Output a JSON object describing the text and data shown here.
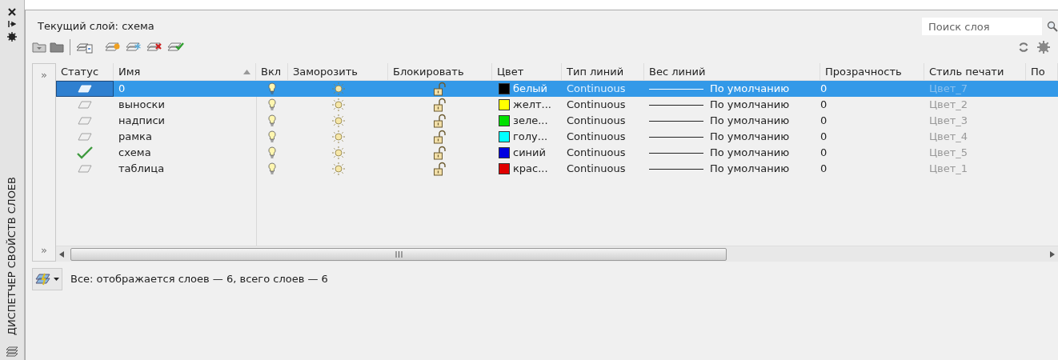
{
  "side_strip": {
    "title": "ДИСПЕТЧЕР СВОЙСТВ СЛОЕВ"
  },
  "current_layer": "Текущий слой: схема",
  "search": {
    "placeholder": "Поиск слоя"
  },
  "expand_marks": [
    "»",
    "»"
  ],
  "table": {
    "columns": [
      {
        "label": "Статус",
        "sorted": false
      },
      {
        "label": "Имя",
        "sorted": true
      },
      {
        "label": "Вкл",
        "sorted": false
      },
      {
        "label": "Заморозить",
        "sorted": false
      },
      {
        "label": "Блокировать",
        "sorted": false
      },
      {
        "label": "Цвет",
        "sorted": false
      },
      {
        "label": "Тип линий",
        "sorted": false
      },
      {
        "label": "Вес линий",
        "sorted": false
      },
      {
        "label": "Прозрачность",
        "sorted": false
      },
      {
        "label": "Стиль печати",
        "sorted": false
      },
      {
        "label": "По",
        "sorted": false
      }
    ],
    "rows": [
      {
        "current": false,
        "name": "0",
        "on": true,
        "frozen": false,
        "locked": false,
        "color": "#000000",
        "color_name": "белый",
        "linetype": "Continuous",
        "lineweight": "По умолчанию",
        "transparency": "0",
        "plot_style": "Цвет_7",
        "selected": true
      },
      {
        "current": false,
        "name": "выноски",
        "on": true,
        "frozen": false,
        "locked": false,
        "color": "#ffff00",
        "color_name": "желт...",
        "linetype": "Continuous",
        "lineweight": "По умолчанию",
        "transparency": "0",
        "plot_style": "Цвет_2",
        "selected": false
      },
      {
        "current": false,
        "name": "надписи",
        "on": true,
        "frozen": false,
        "locked": false,
        "color": "#00e000",
        "color_name": "зеле...",
        "linetype": "Continuous",
        "lineweight": "По умолчанию",
        "transparency": "0",
        "plot_style": "Цвет_3",
        "selected": false
      },
      {
        "current": false,
        "name": "рамка",
        "on": true,
        "frozen": false,
        "locked": false,
        "color": "#00ffff",
        "color_name": "голу...",
        "linetype": "Continuous",
        "lineweight": "По умолчанию",
        "transparency": "0",
        "plot_style": "Цвет_4",
        "selected": false
      },
      {
        "current": true,
        "name": "схема",
        "on": true,
        "frozen": false,
        "locked": false,
        "color": "#0000e0",
        "color_name": "синий",
        "linetype": "Continuous",
        "lineweight": "По умолчанию",
        "transparency": "0",
        "plot_style": "Цвет_5",
        "selected": false
      },
      {
        "current": false,
        "name": "таблица",
        "on": true,
        "frozen": false,
        "locked": false,
        "color": "#e00000",
        "color_name": "крас...",
        "linetype": "Continuous",
        "lineweight": "По умолчанию",
        "transparency": "0",
        "plot_style": "Цвет_1",
        "selected": false
      }
    ]
  },
  "status_bar": "Все: отображается слоев — 6, всего слоев — 6"
}
